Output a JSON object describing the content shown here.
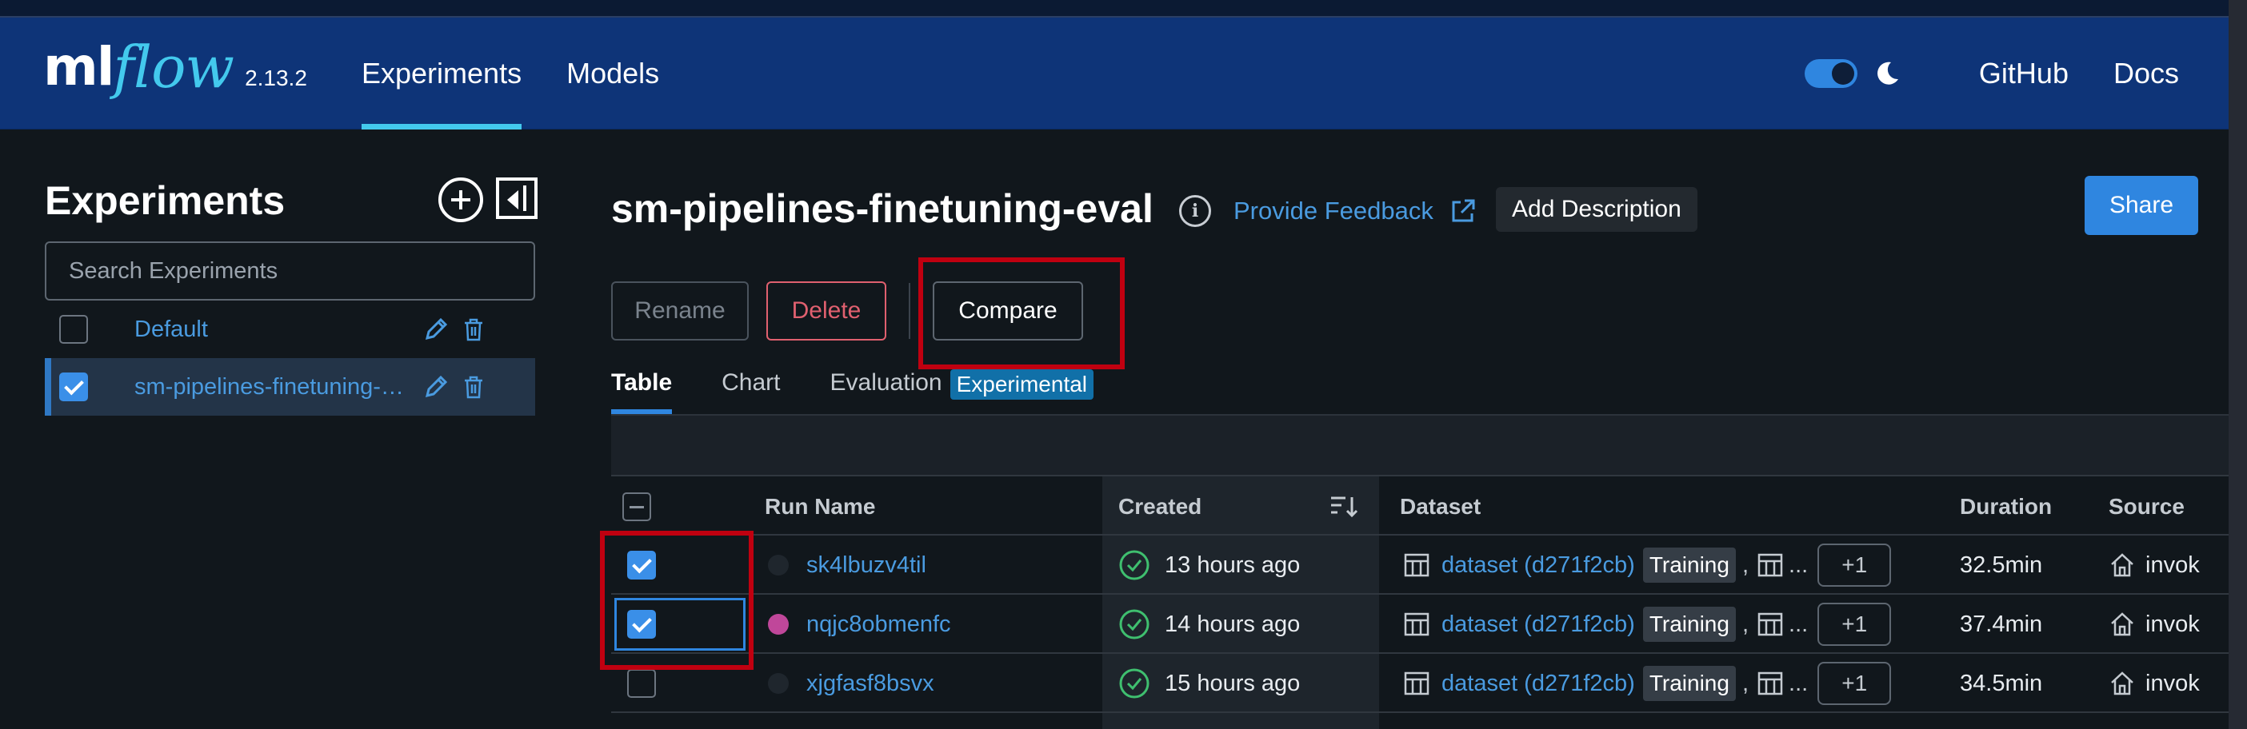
{
  "header": {
    "logo_ml": "ml",
    "logo_flow": "flow",
    "version": "2.13.2",
    "nav": [
      {
        "label": "Experiments",
        "active": true
      },
      {
        "label": "Models",
        "active": false
      }
    ],
    "links": {
      "github": "GitHub",
      "docs": "Docs"
    },
    "theme_toggle": {
      "on": true
    },
    "colors": {
      "bar": "#0e3478",
      "accent": "#43c9ed"
    }
  },
  "sidebar": {
    "title": "Experiments",
    "search_placeholder": "Search Experiments",
    "experiments": [
      {
        "name": "Default",
        "checked": false
      },
      {
        "name": "sm-pipelines-finetuning-eval",
        "checked": true
      }
    ]
  },
  "main": {
    "title": "sm-pipelines-finetuning-eval",
    "feedback_label": "Provide Feedback",
    "add_description_label": "Add Description",
    "share_label": "Share",
    "rename_label": "Rename",
    "delete_label": "Delete",
    "compare_label": "Compare",
    "tabs": [
      {
        "label": "Table",
        "active": true
      },
      {
        "label": "Chart",
        "active": false
      },
      {
        "label": "Evaluation",
        "active": false
      }
    ],
    "experimental_badge": "Experimental"
  },
  "table": {
    "headers": {
      "run_name": "Run Name",
      "created": "Created",
      "dataset": "Dataset",
      "duration": "Duration",
      "source": "Source"
    },
    "rows": [
      {
        "run_name": "sk4lbuzv4til",
        "dot_color": "#1f262d",
        "created": "13 hours ago",
        "dataset": "dataset (d271f2cb)",
        "tag": "Training",
        "ellipsis": "...",
        "more": "+1",
        "duration": "32.5min",
        "source": "invok",
        "checked": true
      },
      {
        "run_name": "nqjc8obmenfc",
        "dot_color": "#c0479a",
        "created": "14 hours ago",
        "dataset": "dataset (d271f2cb)",
        "tag": "Training",
        "ellipsis": "...",
        "more": "+1",
        "duration": "37.4min",
        "source": "invok",
        "checked": true
      },
      {
        "run_name": "xjgfasf8bsvx",
        "dot_color": "#1f262d",
        "created": "15 hours ago",
        "dataset": "dataset (d271f2cb)",
        "tag": "Training",
        "ellipsis": "...",
        "more": "+1",
        "duration": "34.5min",
        "source": "invok",
        "checked": false
      }
    ],
    "comma": ","
  },
  "annotation_color": "#c00010"
}
